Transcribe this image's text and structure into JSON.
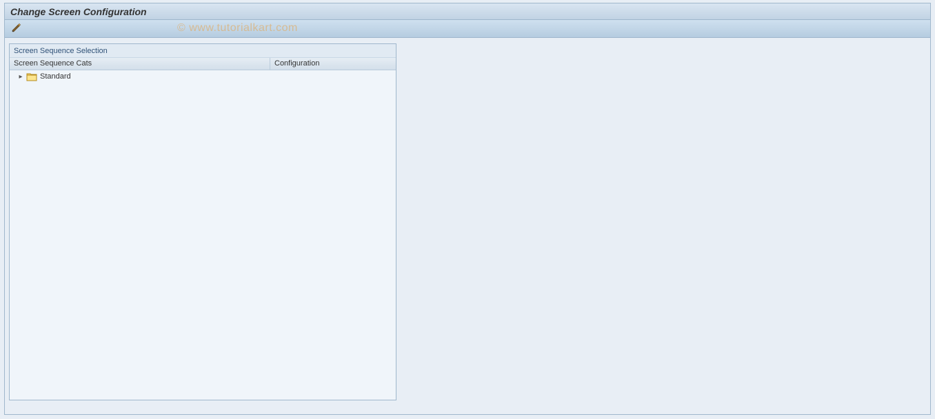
{
  "header": {
    "title": "Change Screen Configuration"
  },
  "toolbar": {
    "edit_button": "Edit"
  },
  "watermark": "© www.tutorialkart.com",
  "panel": {
    "title": "Screen Sequence Selection",
    "columns": {
      "col1": "Screen Sequence Cats",
      "col2": "Configuration"
    },
    "tree": {
      "root_label": "Standard"
    }
  }
}
